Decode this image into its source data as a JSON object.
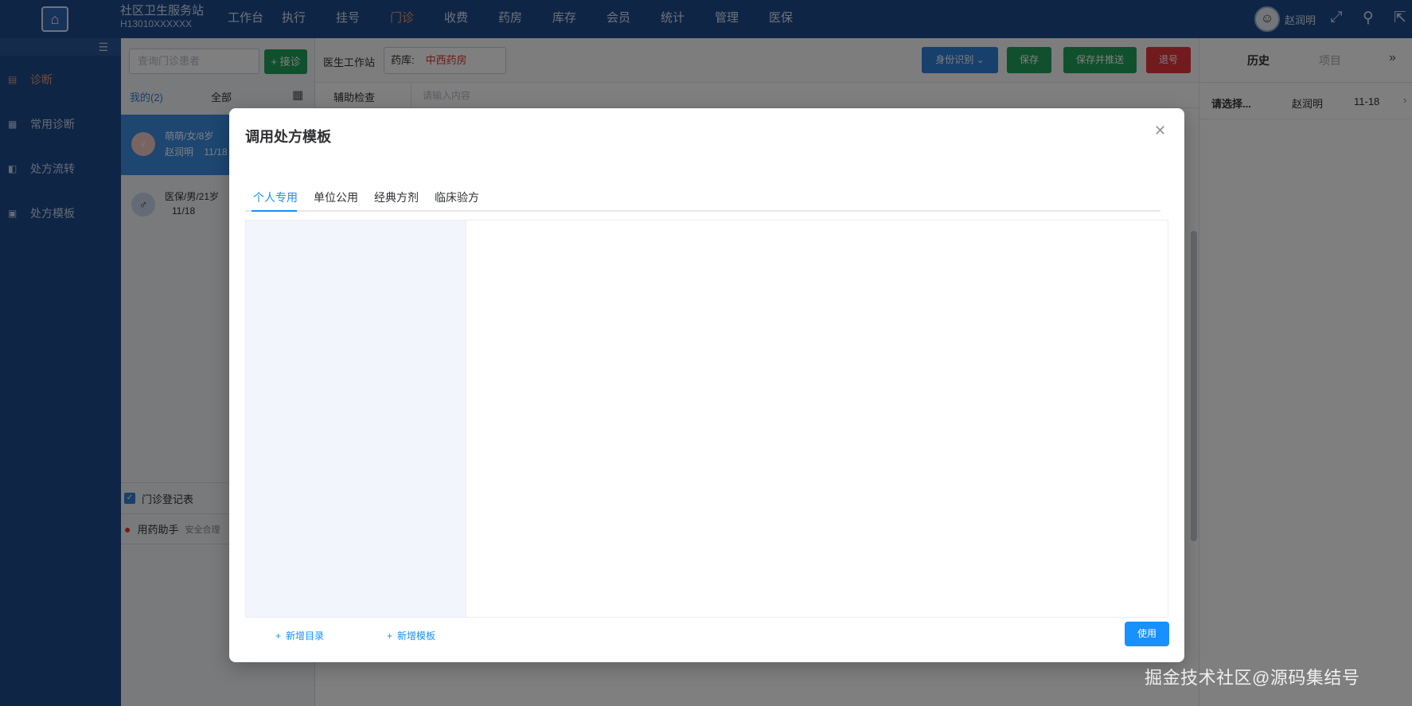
{
  "header": {
    "org_name": "社区卫生服务站",
    "org_code": "H13010XXXXXX",
    "nav": [
      "工作台",
      "执行",
      "挂号",
      "门诊",
      "收费",
      "药房",
      "库存",
      "会员",
      "统计",
      "管理",
      "医保"
    ],
    "active_nav": "门诊",
    "user_name": "赵润明"
  },
  "sidebar": {
    "items": [
      {
        "label": "诊断",
        "icon": "clipboard-icon",
        "active": true
      },
      {
        "label": "常用诊断",
        "icon": "list-icon",
        "active": false
      },
      {
        "label": "处方流转",
        "icon": "transfer-icon",
        "active": false
      },
      {
        "label": "处方模板",
        "icon": "template-icon",
        "active": false
      }
    ]
  },
  "patient_list": {
    "search_placeholder": "查询门诊患者",
    "receive_button": "+ 接诊",
    "tab_mine": "我的(2)",
    "tab_all": "全部",
    "patients": [
      {
        "name_line": "萌萌/女/8岁",
        "doctor": "赵润明",
        "date": "11/18"
      },
      {
        "name_line": "医保/男/21岁",
        "doctor": "",
        "date": "11/18"
      }
    ],
    "register_label": "门诊登记表",
    "helper_label": "用药助手",
    "helper_sub": "安全合理"
  },
  "main": {
    "station_label": "医生工作站",
    "pharmacy_label": "药库:",
    "pharmacy_value": "中西药房",
    "btn_identity": "身份识别",
    "btn_save": "保存",
    "btn_save_push": "保存并推送",
    "btn_refund": "退号",
    "aux_label": "辅助检查",
    "aux_placeholder": "请输入内容"
  },
  "right_panel": {
    "tab_history": "历史",
    "tab_project": "项目",
    "row": {
      "select": "请选择...",
      "doctor": "赵润明",
      "date": "11-18"
    }
  },
  "modal": {
    "title": "调用处方模板",
    "tabs": [
      "个人专用",
      "单位公用",
      "经典方剂",
      "临床验方"
    ],
    "active_tab": "个人专用",
    "add_dir": "新增目录",
    "add_template": "新增模板",
    "use_button": "使用"
  },
  "watermark": "掘金技术社区@源码集结号",
  "colors": {
    "primary": "#1890ff",
    "topbar": "#1e4a8c",
    "green": "#21a05a",
    "red": "#e2373f",
    "accent": "#e59b73"
  }
}
